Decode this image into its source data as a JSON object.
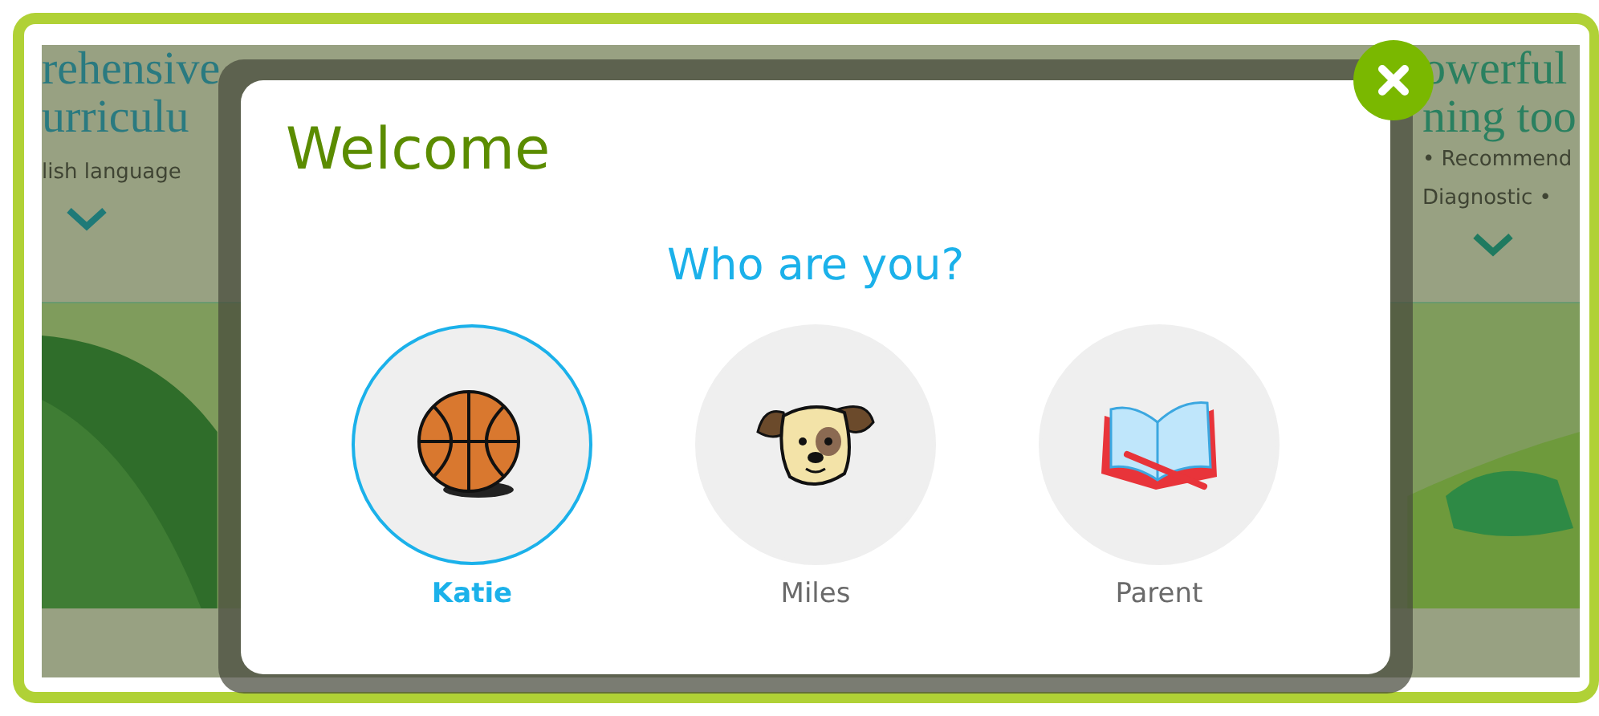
{
  "background": {
    "left_panel": {
      "title_lines": [
        "rehensive",
        "urriculu"
      ],
      "subtitle": "lish language"
    },
    "right_panel": {
      "title_lines": [
        "owerful",
        "ning too"
      ],
      "bullets": [
        "• Recommend",
        "Diagnostic •"
      ]
    }
  },
  "dialog": {
    "title": "Welcome",
    "question": "Who are you?",
    "users": [
      {
        "name": "Katie",
        "kind": "basketball",
        "selected": true
      },
      {
        "name": "Miles",
        "kind": "dog",
        "selected": false
      },
      {
        "name": "Parent",
        "kind": "book",
        "selected": false
      }
    ]
  }
}
